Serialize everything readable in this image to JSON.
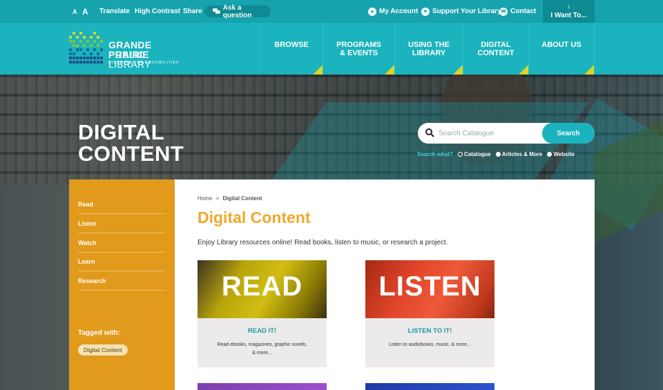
{
  "topbar": {
    "font_small": "A",
    "font_large": "A",
    "translate": "Translate",
    "high_contrast": "High Contrast",
    "share": "Share",
    "ask": "Ask a question",
    "my_account": "My Account",
    "support": "Support Your Library",
    "contact": "Contact",
    "i_want_to": "I Want To..."
  },
  "logo": {
    "line1": "GRANDE PRAIRIE",
    "line2": "PUBLIC LIBRARY",
    "tagline": "DISCOVER THE POSSIBILITIES"
  },
  "nav": {
    "items": [
      {
        "label1": "BROWSE",
        "label2": ""
      },
      {
        "label1": "PROGRAMS",
        "label2": "& EVENTS"
      },
      {
        "label1": "USING THE",
        "label2": "LIBRARY"
      },
      {
        "label1": "DIGITAL",
        "label2": "CONTENT"
      },
      {
        "label1": "ABOUT US",
        "label2": ""
      }
    ]
  },
  "hero": {
    "title_line1": "DIGITAL",
    "title_line2": "CONTENT"
  },
  "search": {
    "placeholder": "Search Catalogue",
    "button": "Search",
    "what_label": "Search what?",
    "options": [
      "Catalogue",
      "Articles & More",
      "Website"
    ],
    "selected": "Website"
  },
  "sidebar": {
    "items": [
      "Read",
      "Listen",
      "Watch",
      "Learn",
      "Research"
    ],
    "tagged_label": "Tagged with:",
    "tag": "Digital Content"
  },
  "main": {
    "breadcrumb_home": "Home",
    "breadcrumb_sep": ">",
    "breadcrumb_current": "Digital Content",
    "title": "Digital Content",
    "intro": "Enjoy Library resources online! Read books, listen to music, or research a project.",
    "cards": [
      {
        "image_text": "READ",
        "title": "READ IT!",
        "desc1": "Read ebooks, magazines, graphic novels,",
        "desc2": "& more..."
      },
      {
        "image_text": "LISTEN",
        "title": "LISTEN TO IT!",
        "desc1": "Listen to audiobooks, music, & more...",
        "desc2": ""
      }
    ]
  },
  "colors": {
    "teal": "#1bb3bd",
    "dark_teal": "#16a3ae",
    "orange_sidebar": "#e19a1c",
    "title_orange": "#f0a82c",
    "nav_triangle": "#d8d531"
  }
}
